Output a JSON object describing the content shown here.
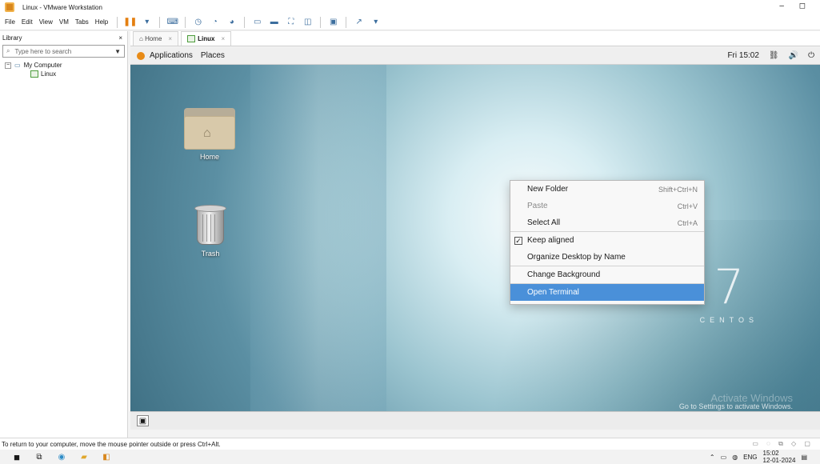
{
  "window": {
    "title": "Linux - VMware Workstation"
  },
  "menu": [
    "File",
    "Edit",
    "View",
    "VM",
    "Tabs",
    "Help"
  ],
  "library": {
    "title": "Library",
    "search_placeholder": "Type here to search",
    "tree": [
      {
        "label": "My Computer"
      },
      {
        "label": "Linux"
      }
    ]
  },
  "tabs": [
    {
      "label": "Home"
    },
    {
      "label": "Linux"
    }
  ],
  "guest": {
    "topbar": {
      "applications": "Applications",
      "places": "Places",
      "time": "Fri 15:02"
    },
    "desktop_icons": [
      {
        "label": "Home"
      },
      {
        "label": "Trash"
      }
    ],
    "context_menu": [
      {
        "label": "New Folder",
        "accel": "Shift+Ctrl+N"
      },
      {
        "label": "Paste",
        "accel": "Ctrl+V"
      },
      {
        "label": "Select All",
        "accel": "Ctrl+A"
      },
      {
        "label": "Keep aligned"
      },
      {
        "label": "Organize Desktop by Name"
      },
      {
        "label": "Change Background"
      },
      {
        "label": "Open Terminal"
      }
    ],
    "centos_logo": {
      "number": "7",
      "word": "CENTOS"
    },
    "activation": {
      "heading": "Activate Windows",
      "message": "Go to Settings to activate Windows."
    }
  },
  "status": {
    "message": "To return to your computer, move the mouse pointer outside or press Ctrl+Alt."
  },
  "taskbar": {
    "lang": "ENG",
    "time": "15:02",
    "date": "12-01-2024"
  }
}
